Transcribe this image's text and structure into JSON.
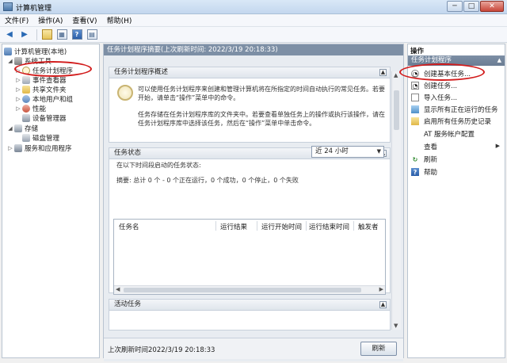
{
  "window": {
    "title": "计算机管理",
    "minimize": "─",
    "maximize": "□",
    "close": "✕"
  },
  "menu": [
    "文件(F)",
    "操作(A)",
    "查看(V)",
    "帮助(H)"
  ],
  "toolbar": {
    "help_label": "?"
  },
  "tree": {
    "root": "计算机管理(本地)",
    "system_tools": "系统工具",
    "task_scheduler": "任务计划程序",
    "event_viewer": "事件查看器",
    "shared_folders": "共享文件夹",
    "local_users": "本地用户和组",
    "performance": "性能",
    "device_manager": "设备管理器",
    "storage": "存储",
    "disk_management": "磁盘管理",
    "services_apps": "服务和应用程序"
  },
  "center": {
    "header": "任务计划程序摘要(上次刷新时间: 2022/3/19 20:18:33)",
    "overview": {
      "title": "任务计划程序概述",
      "para1_line1": "可以使用任务计划程序来创建和管理计算机将在所指定的时间自动执行的常见任务。若要",
      "para1_line2": "开始，请单击“操作”菜单中的命令。",
      "para2_line1": "任务存储在任务计划程序库的文件夹中。若要查看单独任务上的操作或执行该操作，请在",
      "para2_line2": "任务计划程序库中选择该任务，然后在“操作”菜单中单击命令。"
    },
    "status": {
      "title": "任务状态",
      "period_label": "在以下时间段启动的任务状态:",
      "period_value": "近 24 小时",
      "summary": "摘要: 总计 0 个 - 0 个正在运行，0 个成功，0 个停止，0 个失败",
      "columns": [
        "任务名",
        "运行结果",
        "运行开始时间",
        "运行结束时间",
        "触发者"
      ]
    },
    "active": {
      "title": "活动任务"
    },
    "footer": {
      "last_refresh": "上次刷新时间2022/3/19 20:18:33",
      "refresh_label": "刷新"
    }
  },
  "actions": {
    "title": "操作",
    "group": "任务计划程序",
    "items": [
      "创建基本任务...",
      "创建任务...",
      "导入任务...",
      "显示所有正在运行的任务",
      "启用所有任务历史记录",
      "AT 服务帐户配置",
      "查看",
      "刷新",
      "帮助"
    ]
  },
  "colors": {
    "highlight_oval": "#d21c1c",
    "header_bg": "#7d8fa5"
  }
}
